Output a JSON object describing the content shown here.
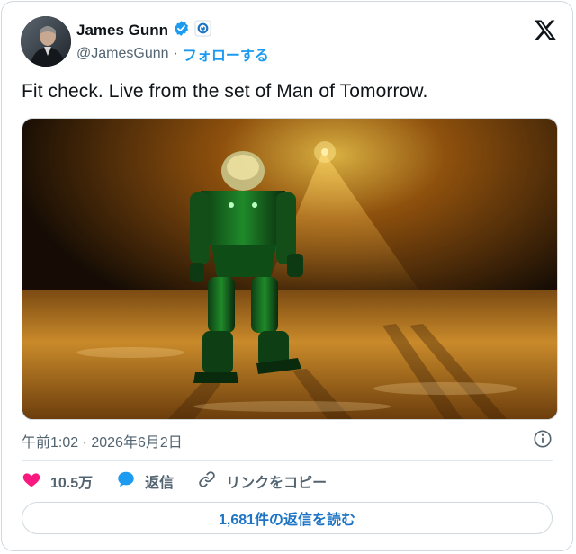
{
  "author": {
    "name": "James Gunn",
    "handle": "@JamesGunn",
    "separator": "·",
    "follow_label": "フォローする"
  },
  "icons": {
    "verified": "verified-badge-icon",
    "affiliate": "affiliate-badge-icon",
    "platform": "x-logo-icon",
    "info": "info-icon",
    "like": "heart-icon",
    "reply": "speech-bubble-icon",
    "copy_link": "link-icon"
  },
  "tweet": {
    "text": "Fit check. Live from the set of Man of Tomorrow.",
    "timestamp": "午前1:02 · 2026年6月2日"
  },
  "actions": {
    "like_count": "10.5万",
    "reply_label": "返信",
    "copy_link_label": "リンクをコピー"
  },
  "footer": {
    "read_replies_label": "1,681件の返信を読む"
  },
  "colors": {
    "accent": "#1d9bf0",
    "like": "#f91880",
    "text": "#0f1419",
    "muted": "#536471"
  }
}
